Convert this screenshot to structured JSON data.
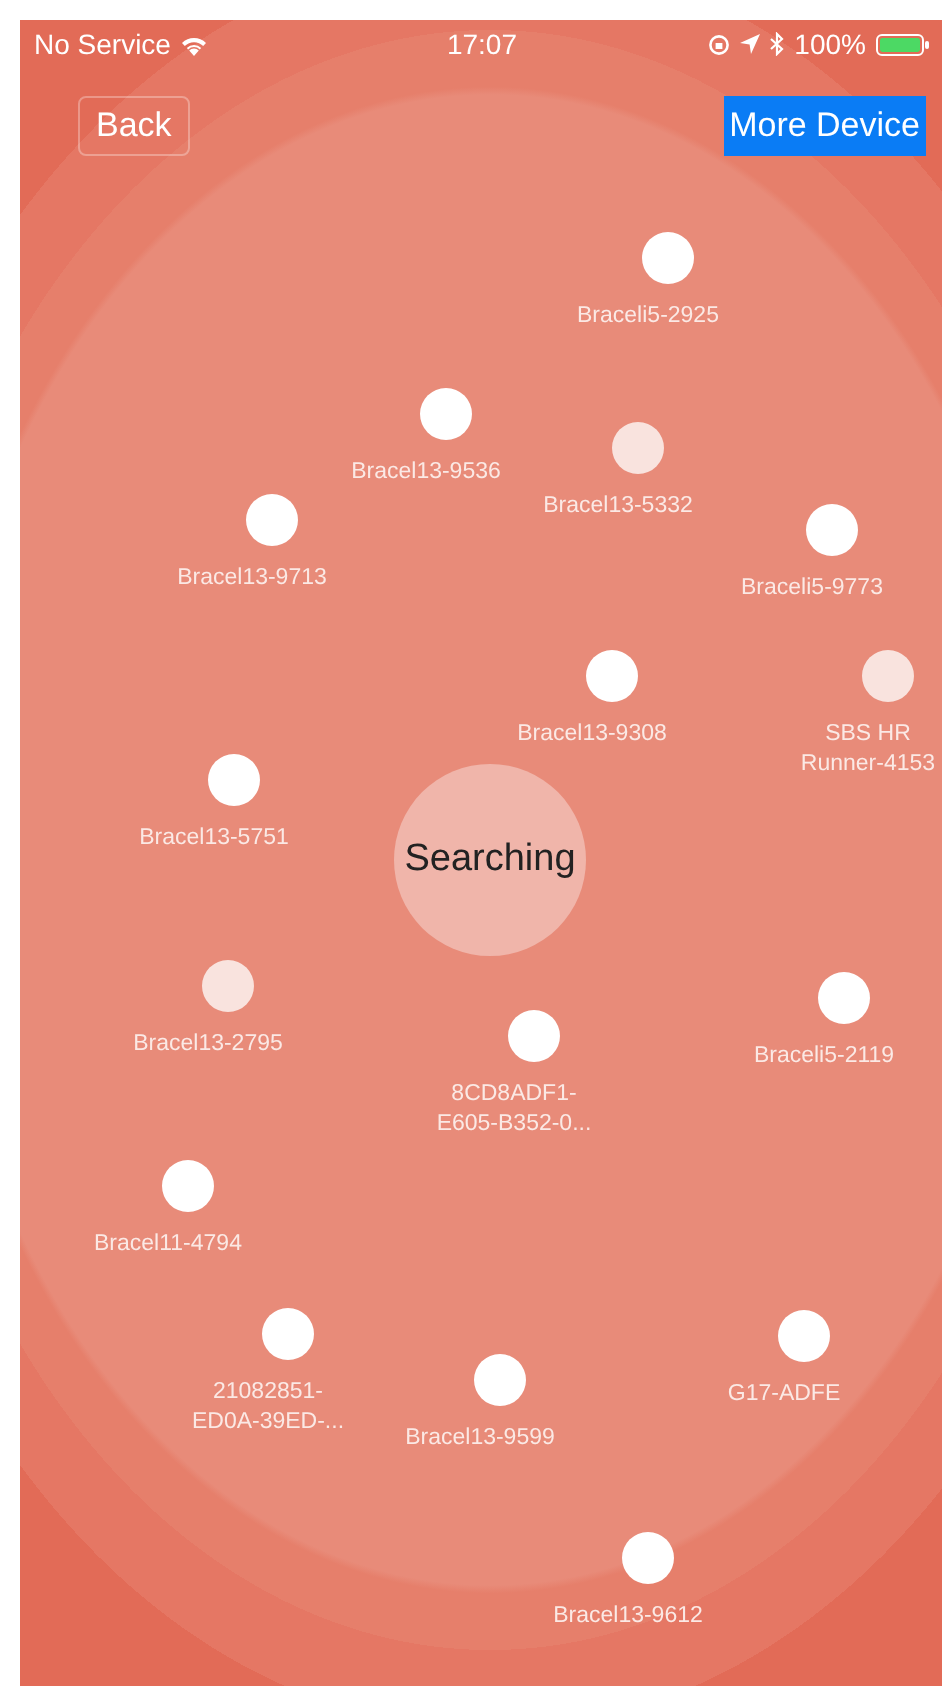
{
  "status_bar": {
    "carrier": "No Service",
    "time": "17:07",
    "battery": "100%"
  },
  "nav": {
    "back": "Back",
    "more": "More Device"
  },
  "center": {
    "label": "Searching"
  },
  "devices": [
    {
      "name": "Braceli5-2925",
      "faded": false
    },
    {
      "name": "Bracel13-9536",
      "faded": false
    },
    {
      "name": "Bracel13-5332",
      "faded": true
    },
    {
      "name": "Bracel13-9713",
      "faded": false
    },
    {
      "name": "Braceli5-9773",
      "faded": false
    },
    {
      "name": "Bracel13-9308",
      "faded": false
    },
    {
      "name": "SBS HR\nRunner-4153",
      "faded": true
    },
    {
      "name": "Bracel13-5751",
      "faded": false
    },
    {
      "name": "Bracel13-2795",
      "faded": true
    },
    {
      "name": "8CD8ADF1-\nE605-B352-0...",
      "faded": false
    },
    {
      "name": "Braceli5-2119",
      "faded": false
    },
    {
      "name": "Bracel11-4794",
      "faded": false
    },
    {
      "name": "21082851-\nED0A-39ED-...",
      "faded": false
    },
    {
      "name": "Bracel13-9599",
      "faded": false
    },
    {
      "name": "G17-ADFE",
      "faded": false
    },
    {
      "name": "Bracel13-9612",
      "faded": false
    }
  ]
}
